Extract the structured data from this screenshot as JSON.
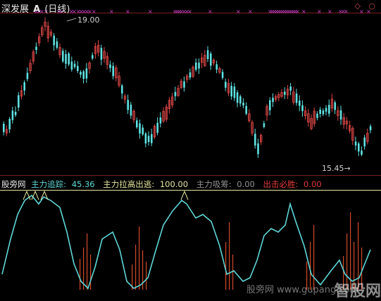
{
  "header": {
    "title": "深发展",
    "glyph": "A",
    "period": "(日线)",
    "window_controls": "◇ ○"
  },
  "main": {
    "high_label": "19.00",
    "low_label": "15.45"
  },
  "indicator": {
    "source": "股旁网",
    "items": [
      {
        "label": "主力追踪:",
        "value": "45.36",
        "color": "#5fd6d6"
      },
      {
        "label": "主力拉高出逃:",
        "value": "100.00",
        "color": "#e6e6a0"
      },
      {
        "label": "主力吸筹:",
        "value": "0.00",
        "color": "#909090"
      },
      {
        "label": "出击必胜:",
        "value": "0.00",
        "color": "#e03a3a"
      }
    ]
  },
  "watermark": {
    "text": "股旁网",
    "url": "www.gupang.com",
    "logo": "智股网",
    "logo_url": "zgpu.com"
  },
  "colors": {
    "up": "#e04848",
    "down": "#5fe0e0",
    "marker": "#d040d0",
    "line": "#5fd6d6",
    "ref": "#e6e6a0",
    "signal": "#d04a2a"
  }
}
